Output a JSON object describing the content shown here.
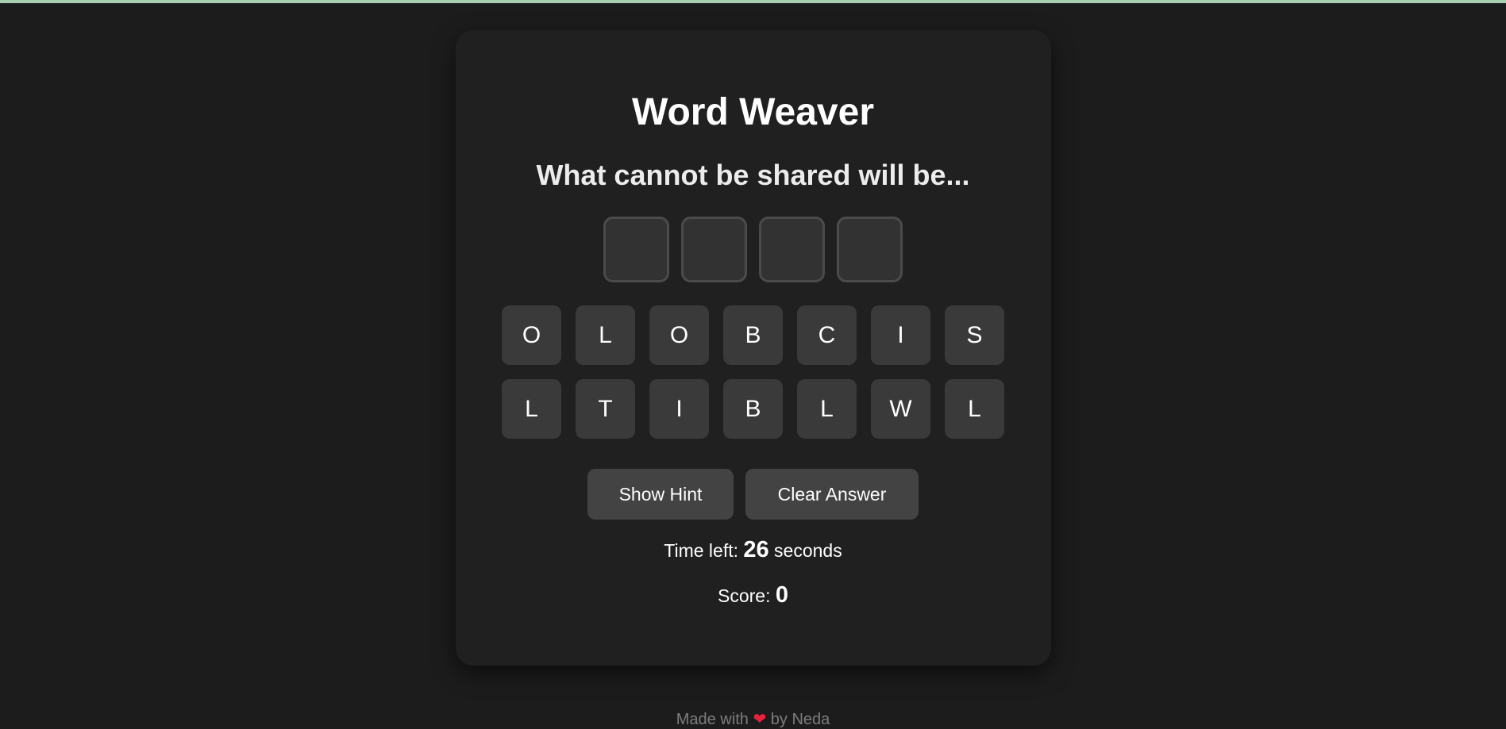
{
  "game": {
    "title": "Word Weaver",
    "clue": "What cannot be shared will be...",
    "answer_slots": [
      "",
      "",
      "",
      ""
    ],
    "letters_row1": [
      "O",
      "L",
      "O",
      "B",
      "C",
      "I",
      "S"
    ],
    "letters_row2": [
      "L",
      "T",
      "I",
      "B",
      "L",
      "W",
      "L"
    ],
    "buttons": {
      "hint_label": "Show Hint",
      "clear_label": "Clear Answer"
    },
    "timer": {
      "prefix": "Time left:",
      "value": "26",
      "suffix": "seconds"
    },
    "score": {
      "prefix": "Score:",
      "value": "0"
    }
  },
  "footer": {
    "prefix": "Made with",
    "heart_icon": "heart-icon",
    "suffix": "by Neda"
  },
  "colors": {
    "background": "#1c1c1c",
    "card": "#202020",
    "tile": "#3a3a3a",
    "button": "#434343",
    "heart": "#e5243b"
  }
}
